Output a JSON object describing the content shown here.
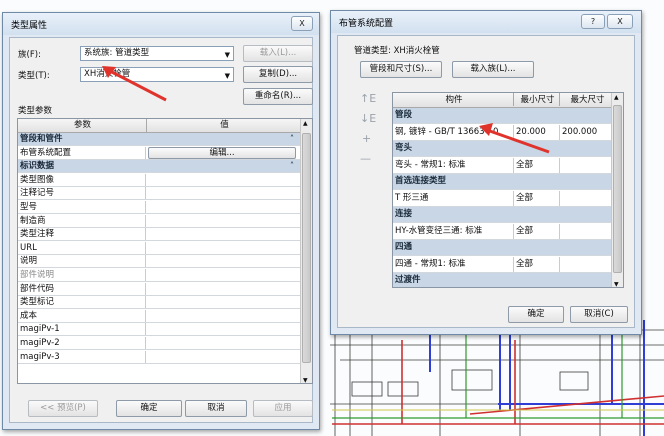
{
  "type_props": {
    "title": "类型属性",
    "close": "X",
    "family_label": "族(F):",
    "family_value": "系统族: 管道类型",
    "type_label": "类型(T):",
    "type_value": "XH消火栓管",
    "load_btn": "载入(L)...",
    "dup_btn": "复制(D)...",
    "rename_btn": "重命名(R)...",
    "params_label": "类型参数",
    "col_param": "参数",
    "col_value": "值",
    "rows": [
      {
        "label": "管段和管件",
        "group": true
      },
      {
        "label": "布管系统配置",
        "value": "编辑..."
      },
      {
        "label": "标识数据",
        "group": true
      },
      {
        "label": "类型图像"
      },
      {
        "label": "注释记号"
      },
      {
        "label": "型号"
      },
      {
        "label": "制造商"
      },
      {
        "label": "类型注释"
      },
      {
        "label": "URL"
      },
      {
        "label": "说明"
      },
      {
        "label": "部件说明",
        "gray": true
      },
      {
        "label": "部件代码"
      },
      {
        "label": "类型标记"
      },
      {
        "label": "成本"
      },
      {
        "label": "magiPv-1"
      },
      {
        "label": "magiPv-2"
      },
      {
        "label": "magiPv-3"
      }
    ],
    "preview_btn": "<< 预览(P)",
    "ok_btn": "确定",
    "cancel_btn": "取消",
    "apply_btn": "应用"
  },
  "routing": {
    "title": "布管系统配置",
    "help": "?",
    "close": "X",
    "pipe_type_label": "管道类型: XH消火栓管",
    "seg_btn": "管段和尺寸(S)...",
    "load_btn": "载入族(L)...",
    "col_member": "构件",
    "col_min": "最小尺寸",
    "col_max": "最大尺寸",
    "side_icons": [
      "↑E",
      "↓E",
      "+",
      "—"
    ],
    "rows": [
      {
        "label": "管段",
        "group": true
      },
      {
        "label": "钢, 镀锌 - GB/T 13663 - 0",
        "min": "20.000",
        "max": "200.000",
        "selected": true
      },
      {
        "label": "弯头",
        "group": true
      },
      {
        "label": "弯头 - 常规1: 标准",
        "min": "全部"
      },
      {
        "label": "首选连接类型",
        "group": true
      },
      {
        "label": "T 形三通",
        "min": "全部"
      },
      {
        "label": "连接",
        "group": true
      },
      {
        "label": "HY-水管变径三通: 标准",
        "min": "全部"
      },
      {
        "label": "四通",
        "group": true
      },
      {
        "label": "四通 - 常规1: 标准",
        "min": "全部"
      },
      {
        "label": "过渡件",
        "group": true
      }
    ],
    "ok_btn": "确定",
    "cancel_btn": "取消(C)"
  }
}
